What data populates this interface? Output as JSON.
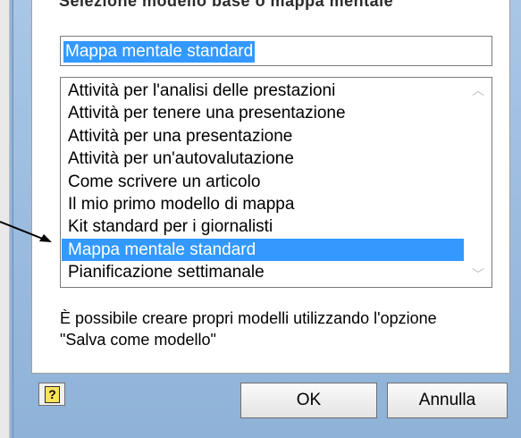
{
  "dialog": {
    "title_partial": "Selezione modello base o mappa mentale",
    "name_value": "Mappa mentale standard",
    "templates": [
      "Attività per l'analisi delle prestazioni",
      "Attività per tenere una presentazione",
      "Attività per una presentazione",
      "Attività per un'autovalutazione",
      "Come scrivere un articolo",
      "Il mio primo modello di mappa",
      "Kit standard per i giornalisti",
      "Mappa mentale standard",
      "Pianificazione settimanale"
    ],
    "selected_index": 7,
    "hint_line1": "È possibile creare propri modelli utilizzando l'opzione",
    "hint_line2": "\"Salva come modello\"",
    "help_glyph": "?",
    "ok_label": "OK",
    "cancel_label": "Annulla"
  },
  "colors": {
    "selection": "#3399ff",
    "frame": "#8fb3d9"
  },
  "icons": {
    "help": "help-icon",
    "scroll_up": "chevron-up-icon",
    "scroll_down": "chevron-down-icon",
    "pointer": "arrow-pointer-icon"
  }
}
